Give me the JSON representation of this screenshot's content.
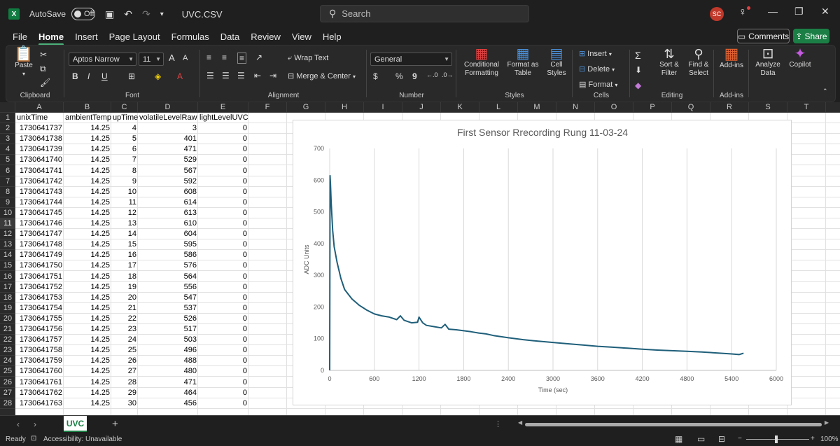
{
  "titlebar": {
    "autosave_label": "AutoSave",
    "autosave_state": "Off",
    "filename": "UVC.CSV",
    "search_placeholder": "Search",
    "user_initials": "SC"
  },
  "menu": [
    "File",
    "Home",
    "Insert",
    "Page Layout",
    "Formulas",
    "Data",
    "Review",
    "View",
    "Help"
  ],
  "menu_active": "Home",
  "comments_label": "Comments",
  "share_label": "Share",
  "ribbon": {
    "clipboard": {
      "label": "Clipboard",
      "paste": "Paste"
    },
    "font": {
      "label": "Font",
      "name": "Aptos Narrow",
      "size": "11",
      "bold": "B",
      "italic": "I",
      "underline": "U",
      "grow": "A",
      "shrink": "A"
    },
    "alignment": {
      "label": "Alignment",
      "wrap": "Wrap Text",
      "merge": "Merge & Center"
    },
    "number": {
      "label": "Number",
      "format": "General",
      "currency": "$",
      "percent": "%",
      "comma": "9"
    },
    "styles": {
      "label": "Styles",
      "conditional": [
        "Conditional",
        "Formatting"
      ],
      "format_table": [
        "Format as",
        "Table"
      ],
      "cell_styles": [
        "Cell",
        "Styles"
      ]
    },
    "cells": {
      "label": "Cells",
      "insert": "Insert",
      "delete": "Delete",
      "format": "Format"
    },
    "editing": {
      "label": "Editing",
      "sort": [
        "Sort &",
        "Filter"
      ],
      "find": [
        "Find &",
        "Select"
      ]
    },
    "addins": {
      "label": "Add-ins",
      "addins": "Add-ins"
    },
    "analyze": {
      "analyze": [
        "Analyze",
        "Data"
      ],
      "copilot": "Copilot"
    }
  },
  "columns": [
    "A",
    "B",
    "C",
    "D",
    "E",
    "F",
    "G",
    "H",
    "I",
    "J",
    "K",
    "L",
    "M",
    "N",
    "O",
    "P",
    "Q",
    "R",
    "S",
    "T"
  ],
  "selected_row": "11",
  "sheet": {
    "headers": [
      "unixTime",
      "ambientTemp",
      "upTime",
      "volatileLevelRaw",
      "lightLevelUVC"
    ],
    "rows": [
      [
        "1730641737",
        "14.25",
        "4",
        "3",
        "0"
      ],
      [
        "1730641738",
        "14.25",
        "5",
        "401",
        "0"
      ],
      [
        "1730641739",
        "14.25",
        "6",
        "471",
        "0"
      ],
      [
        "1730641740",
        "14.25",
        "7",
        "529",
        "0"
      ],
      [
        "1730641741",
        "14.25",
        "8",
        "567",
        "0"
      ],
      [
        "1730641742",
        "14.25",
        "9",
        "592",
        "0"
      ],
      [
        "1730641743",
        "14.25",
        "10",
        "608",
        "0"
      ],
      [
        "1730641744",
        "14.25",
        "11",
        "614",
        "0"
      ],
      [
        "1730641745",
        "14.25",
        "12",
        "613",
        "0"
      ],
      [
        "1730641746",
        "14.25",
        "13",
        "610",
        "0"
      ],
      [
        "1730641747",
        "14.25",
        "14",
        "604",
        "0"
      ],
      [
        "1730641748",
        "14.25",
        "15",
        "595",
        "0"
      ],
      [
        "1730641749",
        "14.25",
        "16",
        "586",
        "0"
      ],
      [
        "1730641750",
        "14.25",
        "17",
        "576",
        "0"
      ],
      [
        "1730641751",
        "14.25",
        "18",
        "564",
        "0"
      ],
      [
        "1730641752",
        "14.25",
        "19",
        "556",
        "0"
      ],
      [
        "1730641753",
        "14.25",
        "20",
        "547",
        "0"
      ],
      [
        "1730641754",
        "14.25",
        "21",
        "537",
        "0"
      ],
      [
        "1730641755",
        "14.25",
        "22",
        "526",
        "0"
      ],
      [
        "1730641756",
        "14.25",
        "23",
        "517",
        "0"
      ],
      [
        "1730641757",
        "14.25",
        "24",
        "503",
        "0"
      ],
      [
        "1730641758",
        "14.25",
        "25",
        "496",
        "0"
      ],
      [
        "1730641759",
        "14.25",
        "26",
        "488",
        "0"
      ],
      [
        "1730641760",
        "14.25",
        "27",
        "480",
        "0"
      ],
      [
        "1730641761",
        "14.25",
        "28",
        "471",
        "0"
      ],
      [
        "1730641762",
        "14.25",
        "29",
        "464",
        "0"
      ],
      [
        "1730641763",
        "14.25",
        "30",
        "456",
        "0"
      ]
    ]
  },
  "chart_data": {
    "type": "line",
    "title": "First Sensor Rrecording Rung 11-03-24",
    "xlabel": "Time (sec)",
    "ylabel": "ADC Units",
    "xlim": [
      0,
      6000
    ],
    "ylim": [
      0,
      700
    ],
    "xticks": [
      "0",
      "600",
      "1200",
      "1800",
      "2400",
      "3000",
      "3600",
      "4200",
      "4800",
      "5400",
      "6000"
    ],
    "yticks": [
      "0",
      "100",
      "200",
      "300",
      "400",
      "500",
      "600",
      "700"
    ],
    "grid": "vertical",
    "color": "#1f5f7a",
    "x": [
      0,
      5,
      10,
      20,
      40,
      60,
      100,
      150,
      200,
      300,
      400,
      500,
      600,
      700,
      800,
      900,
      950,
      1000,
      1100,
      1180,
      1200,
      1250,
      1300,
      1400,
      1500,
      1550,
      1600,
      1700,
      1800,
      1900,
      2000,
      2100,
      2200,
      2400,
      2600,
      2800,
      3000,
      3200,
      3400,
      3600,
      3800,
      4000,
      4200,
      4400,
      4600,
      4800,
      5000,
      5200,
      5400,
      5500,
      5560
    ],
    "y": [
      0,
      614,
      590,
      530,
      440,
      390,
      340,
      290,
      255,
      225,
      205,
      190,
      178,
      172,
      168,
      160,
      172,
      158,
      150,
      152,
      168,
      150,
      142,
      138,
      134,
      145,
      130,
      128,
      125,
      122,
      118,
      115,
      110,
      103,
      97,
      92,
      88,
      84,
      80,
      76,
      73,
      70,
      67,
      64,
      62,
      60,
      58,
      55,
      52,
      50,
      54
    ]
  },
  "sheet_tab": "UVC",
  "status": {
    "ready": "Ready",
    "accessibility": "Accessibility: Unavailable",
    "zoom": "100%"
  }
}
